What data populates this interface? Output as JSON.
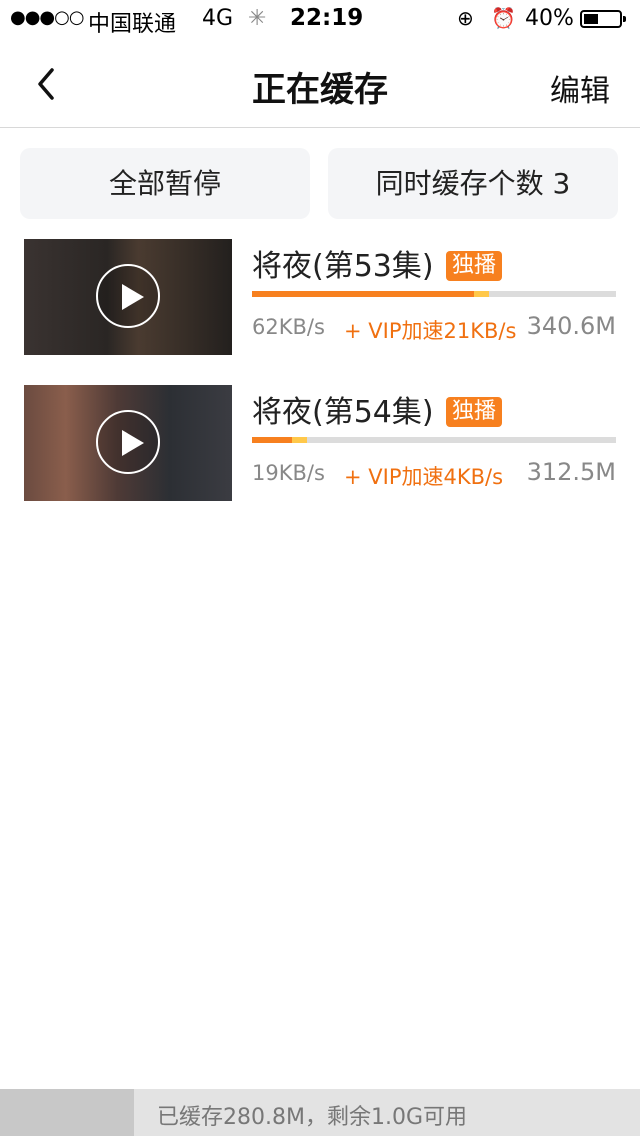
{
  "status_bar": {
    "signal": "●●●○○",
    "carrier": "中国联通",
    "network": "4G",
    "time": "22:19",
    "battery_text": "40%",
    "battery_level": 0.4
  },
  "nav": {
    "title": "正在缓存",
    "edit_label": "编辑"
  },
  "controls": {
    "pause_all_label": "全部暂停",
    "concurrent_label": "同时缓存个数 3"
  },
  "downloads": [
    {
      "title": "将夜(第53集)",
      "badge": "独播",
      "speed": "62KB/s",
      "vip_speed": "+ VIP加速21KB/s",
      "size": "340.6M",
      "progress": 0.61,
      "vip_progress": 0.04
    },
    {
      "title": "将夜(第54集)",
      "badge": "独播",
      "speed": "19KB/s",
      "vip_speed": "+ VIP加速4KB/s",
      "size": "312.5M",
      "progress": 0.11,
      "vip_progress": 0.04
    }
  ],
  "footer": {
    "storage_text": "已缓存280.8M，剩余1.0G可用",
    "used_fraction": 0.21
  },
  "colors": {
    "accent": "#f7801f",
    "vip_text": "#f07010",
    "vip_bar": "#ffc84a"
  }
}
